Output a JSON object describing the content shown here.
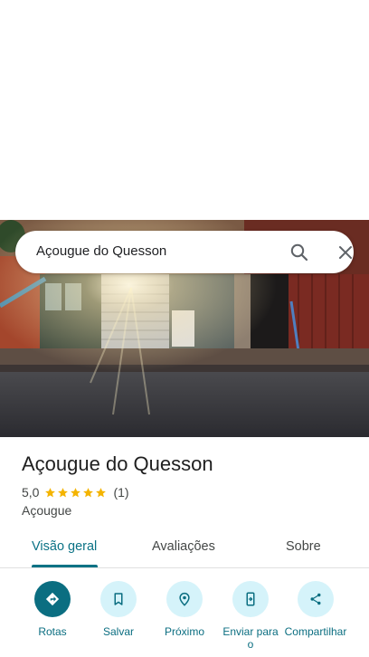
{
  "search": {
    "query": "Açougue do Quesson"
  },
  "place": {
    "name": "Açougue do Quesson",
    "rating": "5,0",
    "stars": 5,
    "review_count": "(1)",
    "category": "Açougue"
  },
  "tabs": [
    {
      "label": "Visão geral",
      "active": true
    },
    {
      "label": "Avaliações",
      "active": false
    },
    {
      "label": "Sobre",
      "active": false
    }
  ],
  "actions": [
    {
      "label": "Rotas",
      "icon": "directions-icon"
    },
    {
      "label": "Salvar",
      "icon": "bookmark-icon"
    },
    {
      "label": "Próximo",
      "icon": "nearby-icon"
    },
    {
      "label": "Enviar para o",
      "icon": "send-to-phone-icon"
    },
    {
      "label": "Compartilhar",
      "icon": "share-icon"
    }
  ],
  "colors": {
    "accent": "#0b6e81",
    "action_bg": "#d5f3fa",
    "star": "#f4b400"
  }
}
